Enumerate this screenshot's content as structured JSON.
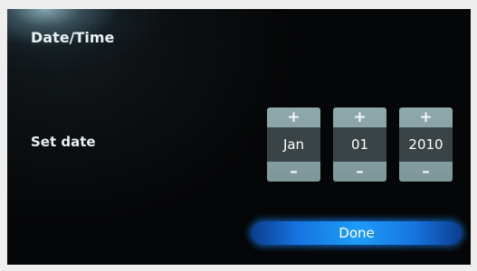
{
  "screen": {
    "title": "Date/Time",
    "set_date_label": "Set date"
  },
  "date_picker": {
    "month": {
      "increment": "+",
      "value": "Jan",
      "decrement": "–"
    },
    "day": {
      "increment": "+",
      "value": "01",
      "decrement": "–"
    },
    "year": {
      "increment": "+",
      "value": "2010",
      "decrement": "–"
    }
  },
  "done_button": {
    "label": "Done"
  },
  "colors": {
    "background": "#050607",
    "spinner": "#8ea8ac",
    "spinner_value_bg": "#3a4446",
    "done_accent": "#1e9cf8"
  }
}
